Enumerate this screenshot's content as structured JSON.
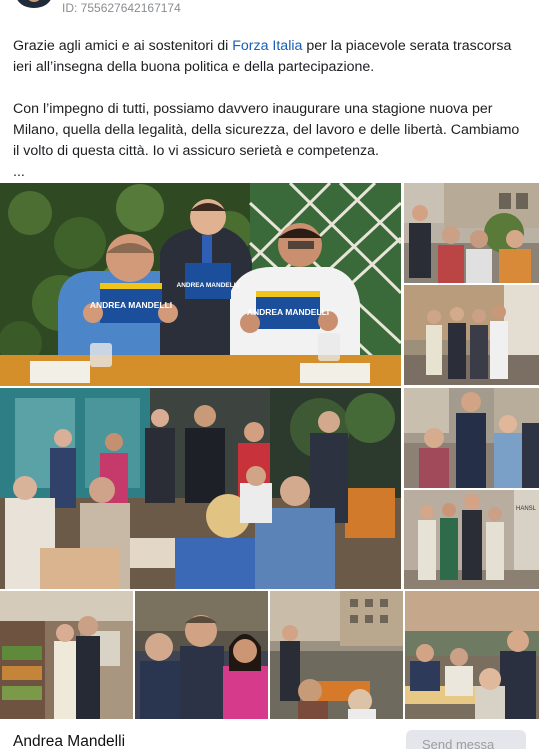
{
  "post": {
    "id_label": "ID: 755627642167174",
    "text": {
      "p1_before": "Grazie agli amici e ai sostenitori di ",
      "p1_link": "Forza Italia",
      "p1_after": " per la piacevole serata trascorsa ieri all’insegna della buona politica e della partecipazione.",
      "p2": "Con l’impegno di tutti, possiamo davvero inaugurare una stagione nuova per Milano, quella della legalità, della sicurezza, del lavoro e delle libertà. Cambiamo il volto di questa città. Io vi assicuro serietà e competenza.",
      "see_more": "..."
    },
    "photos": [
      {
        "id": "photo-main-flyers",
        "flyer_name": "ANDREA MANDELLI",
        "accent": "#1b4e9b"
      },
      {
        "id": "photo-street-left"
      },
      {
        "id": "photo-street-group"
      },
      {
        "id": "photo-restaurant-applause"
      },
      {
        "id": "photo-outdoor-crowd"
      },
      {
        "id": "photo-wall-group",
        "wall_text": "HANSL"
      },
      {
        "id": "photo-indoor-buffet"
      },
      {
        "id": "photo-selfie-trio"
      },
      {
        "id": "photo-terrace-tables"
      },
      {
        "id": "photo-crowd-tables"
      }
    ]
  },
  "footer": {
    "author_name": "Andrea Mandelli",
    "send_button_label": "Send messa"
  },
  "colors": {
    "link": "#1a5fb4",
    "id_text": "#8a8d91",
    "button_bg": "#e4e6eb",
    "button_text": "#9a9da2"
  }
}
